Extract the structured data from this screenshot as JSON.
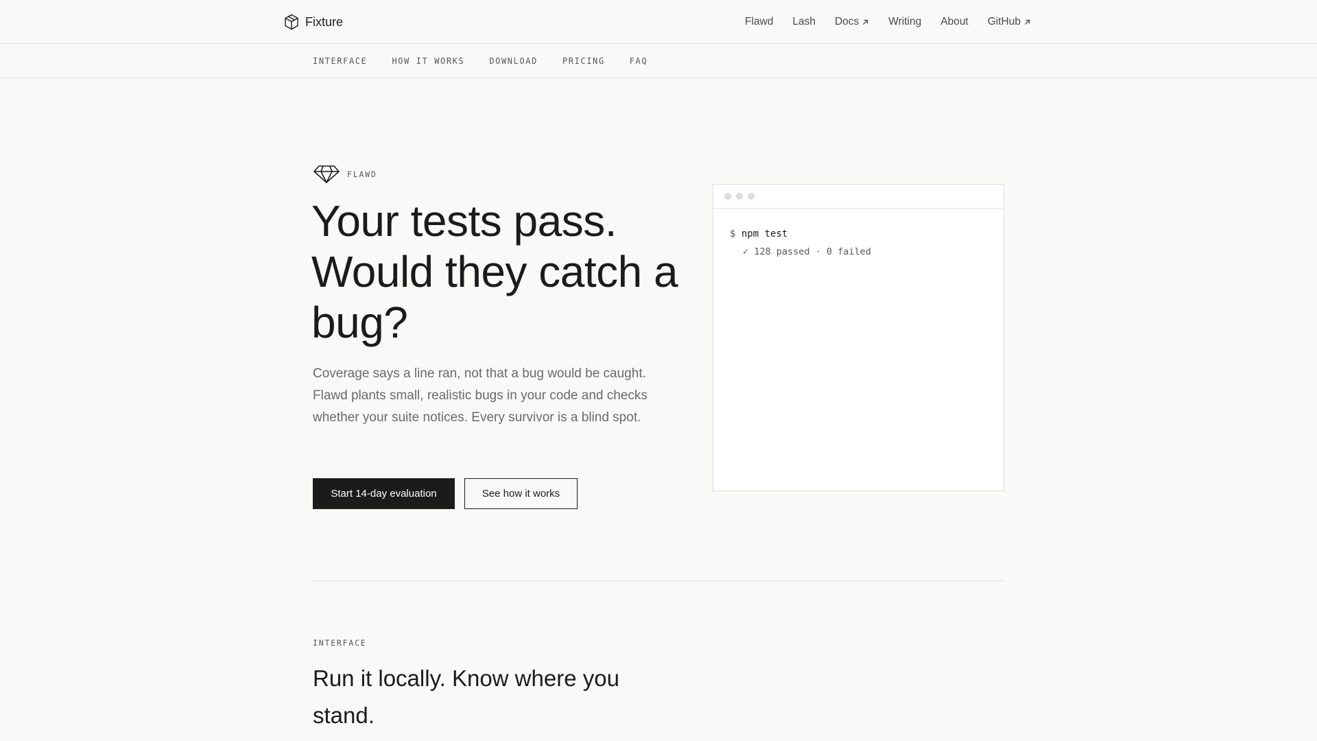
{
  "header": {
    "brand": "Fixture",
    "nav": [
      {
        "label": "Flawd",
        "external": false
      },
      {
        "label": "Lash",
        "external": false
      },
      {
        "label": "Docs",
        "external": true
      },
      {
        "label": "Writing",
        "external": false
      },
      {
        "label": "About",
        "external": false
      },
      {
        "label": "GitHub",
        "external": true
      }
    ]
  },
  "subnav": [
    "INTERFACE",
    "HOW IT WORKS",
    "DOWNLOAD",
    "PRICING",
    "FAQ"
  ],
  "hero": {
    "eyebrow": "FLAWD",
    "title": "Your tests pass. Would they catch a bug?",
    "subtitle": "Coverage says a line ran, not that a bug would be caught. Flawd plants small, realistic bugs in your code and checks whether your suite notices. Every survivor is a blind spot.",
    "primary_cta": "Start 14-day evaluation",
    "secondary_cta": "See how it works"
  },
  "terminal": {
    "prompt": "$",
    "command": "npm test",
    "result": "✓ 128 passed · 0 failed"
  },
  "section": {
    "eyebrow": "INTERFACE",
    "title": "Run it locally. Know where you stand."
  }
}
